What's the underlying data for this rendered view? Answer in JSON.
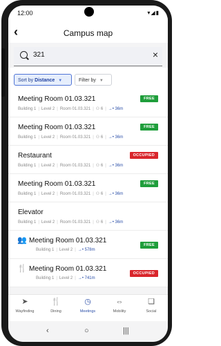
{
  "status": {
    "time": "12:00",
    "system_icons": "▾◢▮"
  },
  "header": {
    "title": "Campus map",
    "back_icon": "chevron-left-icon"
  },
  "search": {
    "value": "321",
    "clear_icon": "×"
  },
  "filters": {
    "sort_prefix": "Sort by",
    "sort_value": "Distance",
    "filter_label": "Filter by"
  },
  "colors": {
    "free": "#1f9e3b",
    "occupied": "#d9262c",
    "accent": "#2a4ea8"
  },
  "items": [
    {
      "name": "Meeting Room 01.03.321",
      "building": "Building 1",
      "level": "Level 2",
      "room": "Room 01.03.321",
      "capacity": "6",
      "distance": "36m",
      "status": "FREE"
    },
    {
      "name": "Meeting Room 01.03.321",
      "building": "Building 1",
      "level": "Level 2",
      "room": "Room 01.03.321",
      "capacity": "6",
      "distance": "36m",
      "status": "FREE"
    },
    {
      "name": "Restaurant",
      "building": "Building 1",
      "level": "Level 2",
      "room": "Room 01.03.321",
      "capacity": "6",
      "distance": "36m",
      "status": "OCCUPIED"
    },
    {
      "name": "Meeting Room 01.03.321",
      "building": "Building 1",
      "level": "Level 2",
      "room": "Room 01.03.321",
      "capacity": "6",
      "distance": "36m",
      "status": "FREE"
    },
    {
      "name": "Elevator",
      "building": "Building 1",
      "level": "Level 2",
      "room": "Room 01.03.321",
      "capacity": "6",
      "distance": "36m",
      "status": ""
    },
    {
      "name": "Meeting Room 01.03.321",
      "building": "Building 1",
      "level": "Level 2",
      "distance": "578m",
      "status": "FREE",
      "lead_icon": "people-icon"
    },
    {
      "name": "Meeting Room 01.03.321",
      "building": "Building 1",
      "level": "Level 2",
      "distance": "741m",
      "status": "OCCUPIED",
      "lead_icon": "restaurant-icon"
    }
  ],
  "tabs": [
    {
      "label": "Wayfinding",
      "icon": "navigation-icon"
    },
    {
      "label": "Dining",
      "icon": "dining-icon"
    },
    {
      "label": "Meetings",
      "icon": "clock-icon",
      "active": true
    },
    {
      "label": "Mobility",
      "icon": "car-icon"
    },
    {
      "label": "Social",
      "icon": "chat-icon"
    }
  ]
}
